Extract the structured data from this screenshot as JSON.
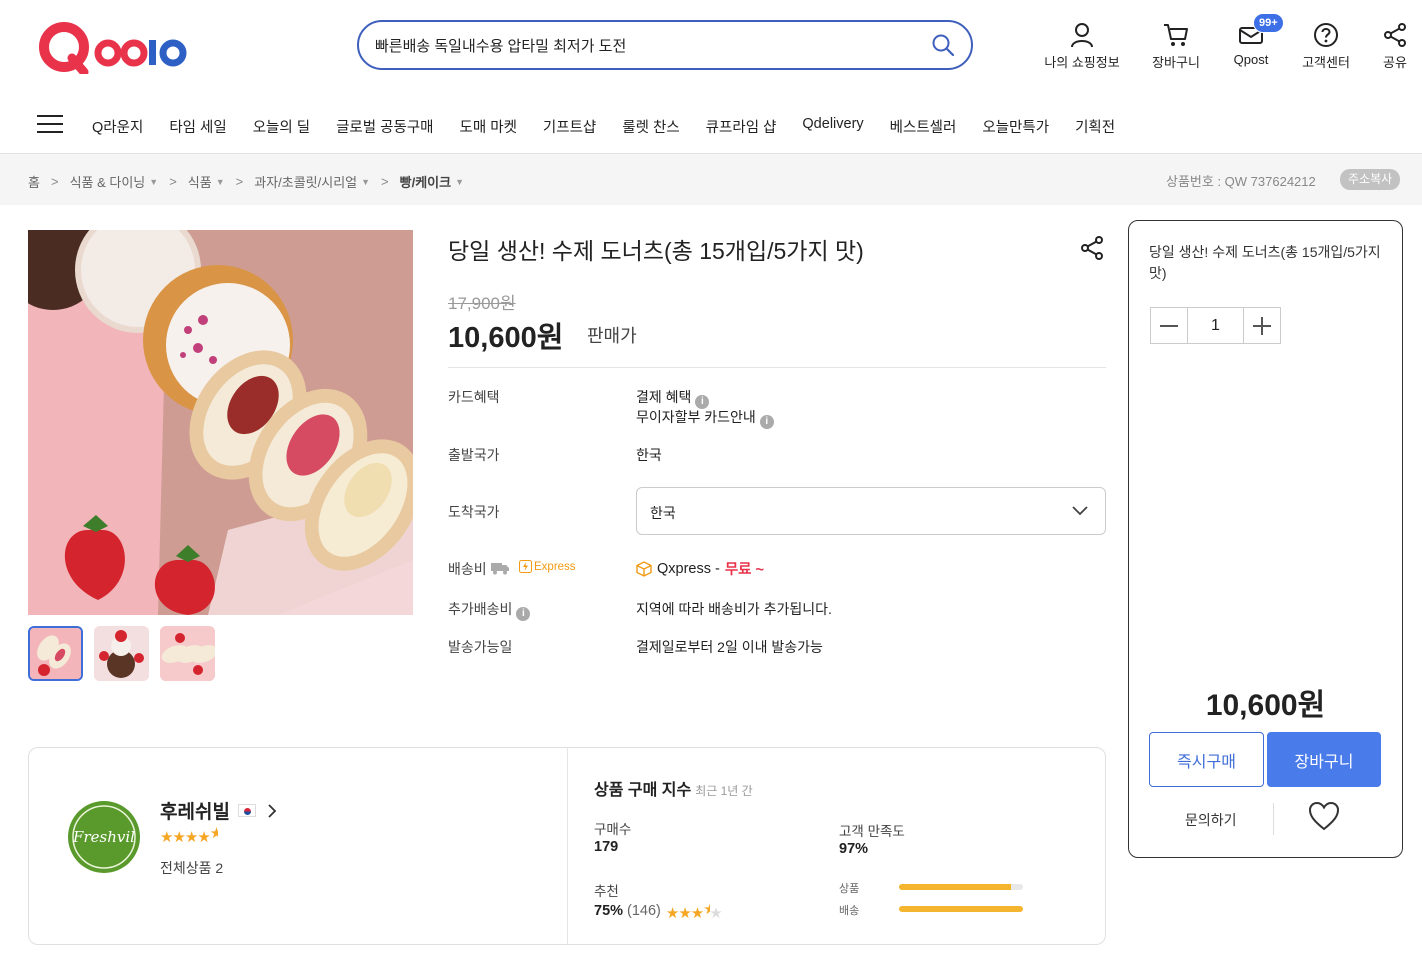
{
  "header": {
    "logo_text": "Qoo10",
    "search_value": "빠른배송 독일내수용 압타밀 최저가 도전",
    "icons": [
      {
        "label": "나의 쇼핑정보",
        "icon": "user-icon"
      },
      {
        "label": "장바구니",
        "icon": "cart-icon"
      },
      {
        "label": "Qpost",
        "icon": "mail-icon",
        "badge": "99+"
      },
      {
        "label": "고객센터",
        "icon": "help-icon"
      },
      {
        "label": "공유",
        "icon": "share-icon"
      }
    ]
  },
  "nav": {
    "items": [
      "Q라운지",
      "타임 세일",
      "오늘의 딜",
      "글로벌 공동구매",
      "도매 마켓",
      "기프트샵",
      "룰렛 찬스",
      "큐프라임 샵",
      "Qdelivery",
      "베스트셀러",
      "오늘만특가",
      "기획전"
    ]
  },
  "breadcrumb": {
    "items": [
      "홈",
      "식품 & 다이닝",
      "식품",
      "과자/초콜릿/시리얼",
      "빵/케이크"
    ],
    "product_no": "상품번호 : QW 737624212",
    "copy_label": "주소복사"
  },
  "product": {
    "title": "당일 생산! 수제 도너츠(총 15개입/5가지 맛)",
    "old_price": "17,900원",
    "price": "10,600원",
    "price_label": "판매가",
    "card_label": "카드혜택",
    "card_line1": "결제 혜택",
    "card_line2": "무이자할부 카드안내",
    "origin_label": "출발국가",
    "origin_value": "한국",
    "dest_label": "도착국가",
    "dest_value": "한국",
    "shipping_label": "배송비",
    "express_label": "Express",
    "shipping_carrier": "Qxpress -",
    "shipping_free": "무료 ~",
    "extra_label": "추가배송비",
    "extra_value": "지역에 따라 배송비가 추가됩니다.",
    "ship_date_label": "발송가능일",
    "ship_date_value": "결제일로부터 2일 이내 발송가능"
  },
  "seller": {
    "name": "후레쉬빌",
    "logo_text": "Freshvil",
    "rating": 4.5,
    "total_products": "전체상품 2",
    "index_title": "상품 구매 지수",
    "index_sub": "최근 1년 간",
    "purchases_label": "구매수",
    "purchases_value": "179",
    "satisfaction_label": "고객 만족도",
    "satisfaction_value": "97%",
    "recommend_label": "추천",
    "recommend_value": "75%",
    "recommend_count": "(146)",
    "recommend_stars": 3.5,
    "product_bar_label": "상품",
    "product_bar_level": 0.9,
    "delivery_bar_label": "배송",
    "delivery_bar_level": 1.0
  },
  "side_panel": {
    "title": "당일 생산! 수제 도너츠(총 15개입/5가지 맛)",
    "quantity": "1",
    "price": "10,600원",
    "buy_now": "즉시구매",
    "add_cart": "장바구니",
    "inquiry": "문의하기"
  },
  "colors": {
    "brand_red": "#e8334a",
    "brand_blue": "#2d5fc4",
    "accent_blue": "#4a7bea",
    "star": "#f5a623",
    "free_red": "#e8334a"
  }
}
